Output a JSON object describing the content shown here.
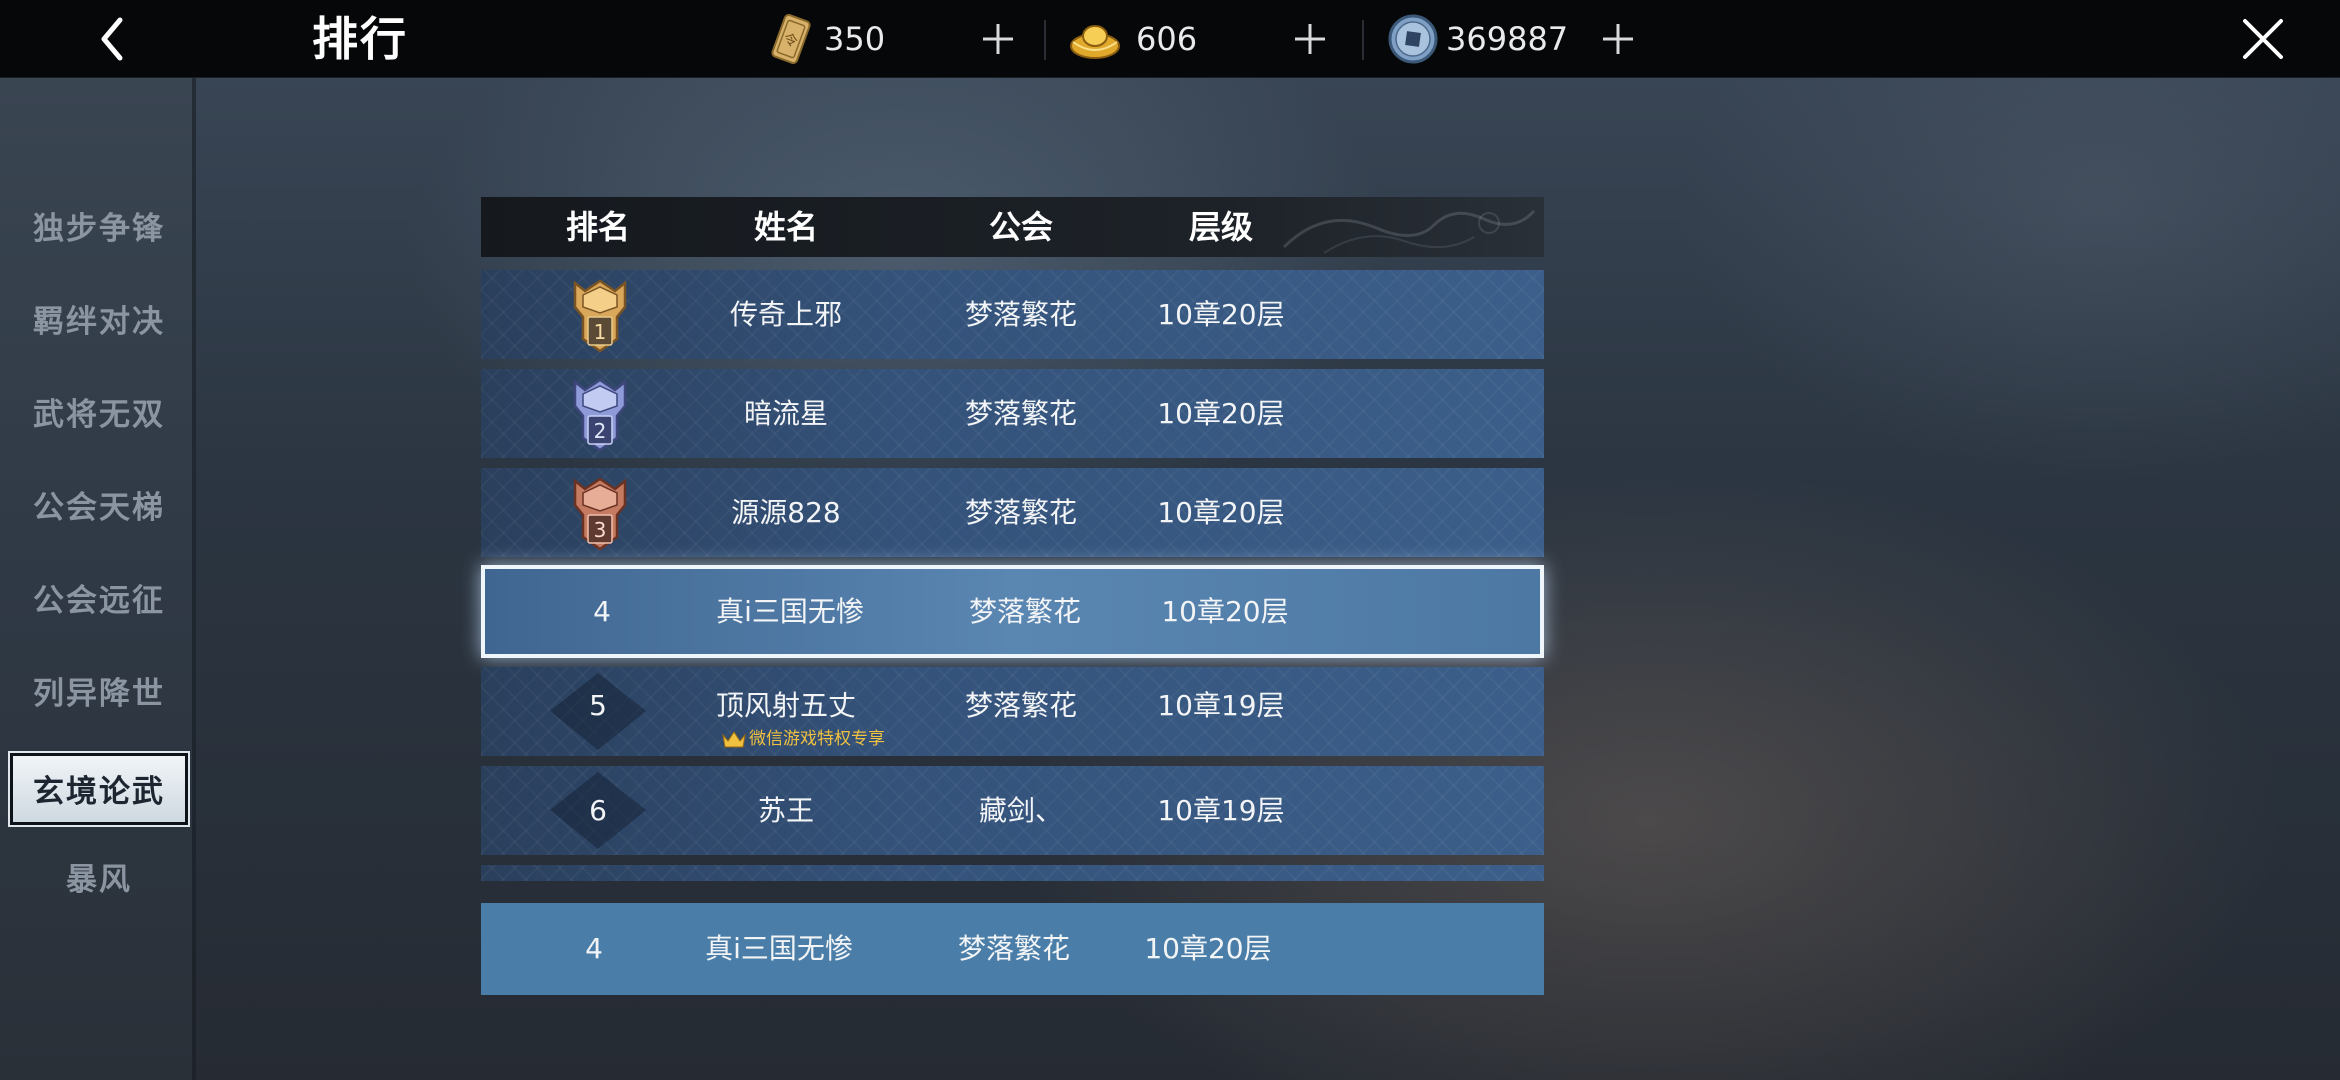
{
  "header": {
    "title": "排行",
    "resources": [
      {
        "icon": "token-card-icon",
        "value": "350"
      },
      {
        "icon": "gold-ingot-icon",
        "value": "606"
      },
      {
        "icon": "copper-coin-icon",
        "value": "369887"
      }
    ]
  },
  "sidebar": {
    "items": [
      {
        "label": "独步争锋",
        "active": false
      },
      {
        "label": "羁绊对决",
        "active": false
      },
      {
        "label": "武将无双",
        "active": false
      },
      {
        "label": "公会天梯",
        "active": false
      },
      {
        "label": "公会远征",
        "active": false
      },
      {
        "label": "列异降世",
        "active": false
      },
      {
        "label": "玄境论武",
        "active": true
      },
      {
        "label": "暴风",
        "active": false
      }
    ]
  },
  "table": {
    "columns": [
      "排名",
      "姓名",
      "公会",
      "层级"
    ],
    "rows": [
      {
        "rank": "1",
        "name": "传奇上邪",
        "guild": "梦落繁花",
        "level": "10章20层"
      },
      {
        "rank": "2",
        "name": "暗流星",
        "guild": "梦落繁花",
        "level": "10章20层"
      },
      {
        "rank": "3",
        "name": "源源828",
        "guild": "梦落繁花",
        "level": "10章20层"
      },
      {
        "rank": "4",
        "name": "真i三国无惨",
        "guild": "梦落繁花",
        "level": "10章20层"
      },
      {
        "rank": "5",
        "name": "顶风射五丈",
        "guild": "梦落繁花",
        "level": "10章19层",
        "badge": "微信游戏特权专享"
      },
      {
        "rank": "6",
        "name": "苏王",
        "guild": "藏剑、",
        "level": "10章19层"
      }
    ],
    "my_rank": {
      "rank": "4",
      "name": "真i三国无惨",
      "guild": "梦落繁花",
      "level": "10章20层"
    }
  },
  "colors": {
    "medal_gold": "#d9a85a",
    "medal_silver": "#8e9bd8",
    "medal_bronze": "#c57a62",
    "privilege_text": "#f0c040",
    "my_row_bg": "#4a7ea8"
  }
}
